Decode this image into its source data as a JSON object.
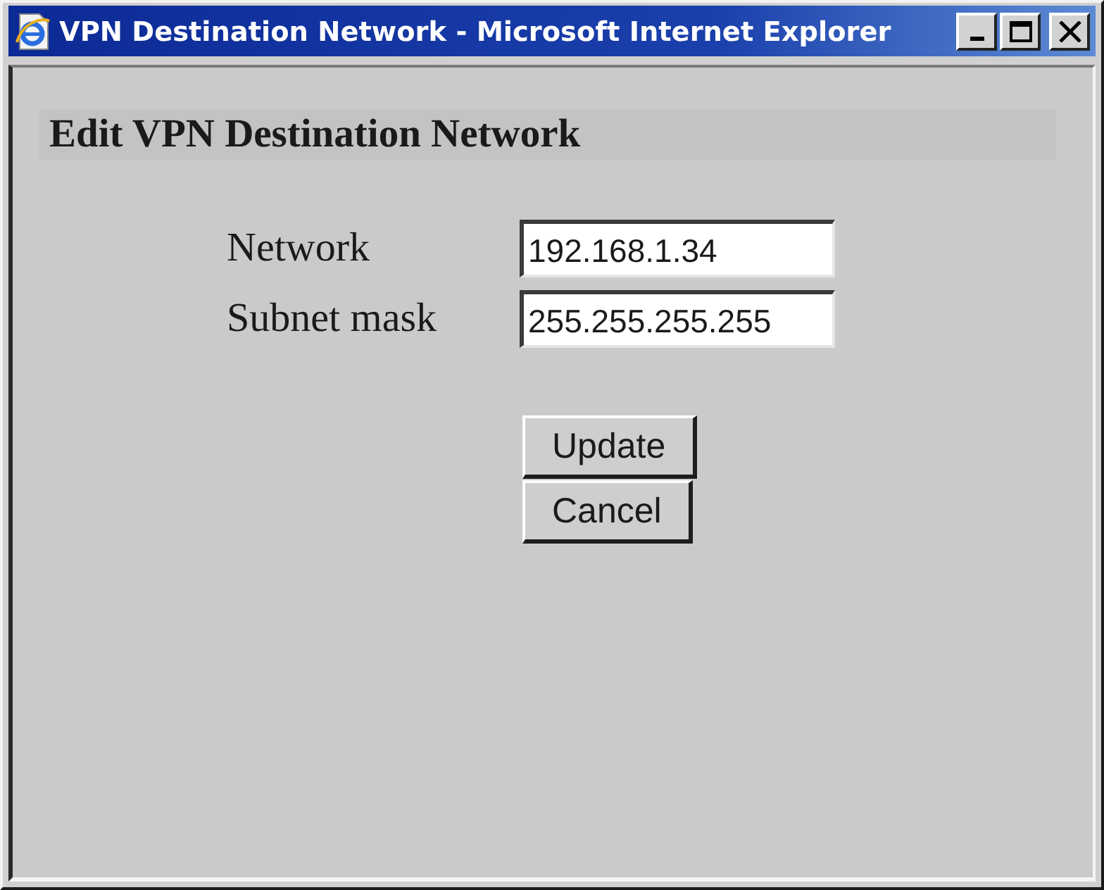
{
  "window": {
    "title": "VPN Destination Network - Microsoft Internet Explorer",
    "controls": [
      {
        "kind": "minimize"
      },
      {
        "kind": "maximize"
      },
      {
        "kind": "close"
      }
    ]
  },
  "heading": "Edit VPN Destination Network",
  "fields": [
    {
      "label": "Network",
      "value": "192.168.1.34"
    },
    {
      "label": "Subnet mask",
      "value": "255.255.255.255"
    }
  ],
  "buttons": [
    {
      "label": "Update"
    },
    {
      "label": "Cancel"
    }
  ]
}
